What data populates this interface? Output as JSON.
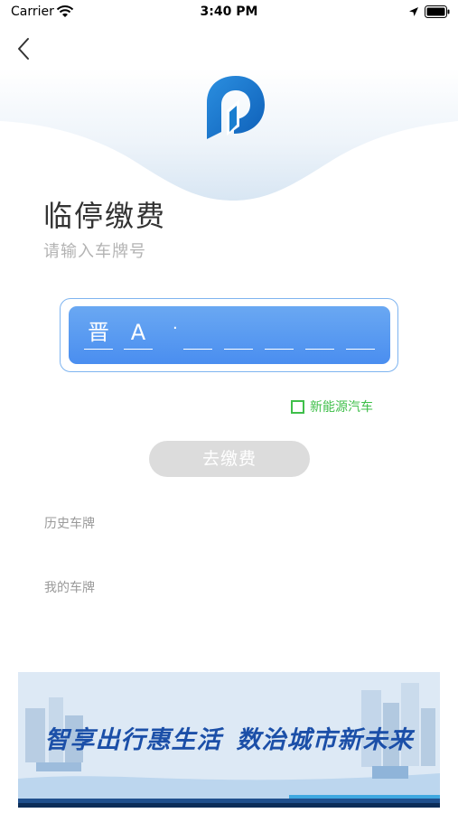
{
  "status_bar": {
    "carrier": "Carrier",
    "time": "3:40 PM"
  },
  "page": {
    "title": "临停缴费",
    "subtitle": "请输入车牌号"
  },
  "plate": {
    "characters": [
      "晋",
      "A",
      "",
      "",
      "",
      "",
      ""
    ],
    "separator": "·"
  },
  "new_energy": {
    "label": "新能源汽车",
    "checked": false
  },
  "pay_button": {
    "label": "去缴费"
  },
  "sections": {
    "history": "历史车牌",
    "my_plates": "我的车牌"
  },
  "banner": {
    "text_left": "智享出行惠生活",
    "text_right": "数治城市新未来"
  },
  "colors": {
    "accent": "#4a8ef0",
    "green": "#3fbf4a",
    "logo": "#1a7fd0",
    "button_disabled": "#dcdcdc"
  }
}
